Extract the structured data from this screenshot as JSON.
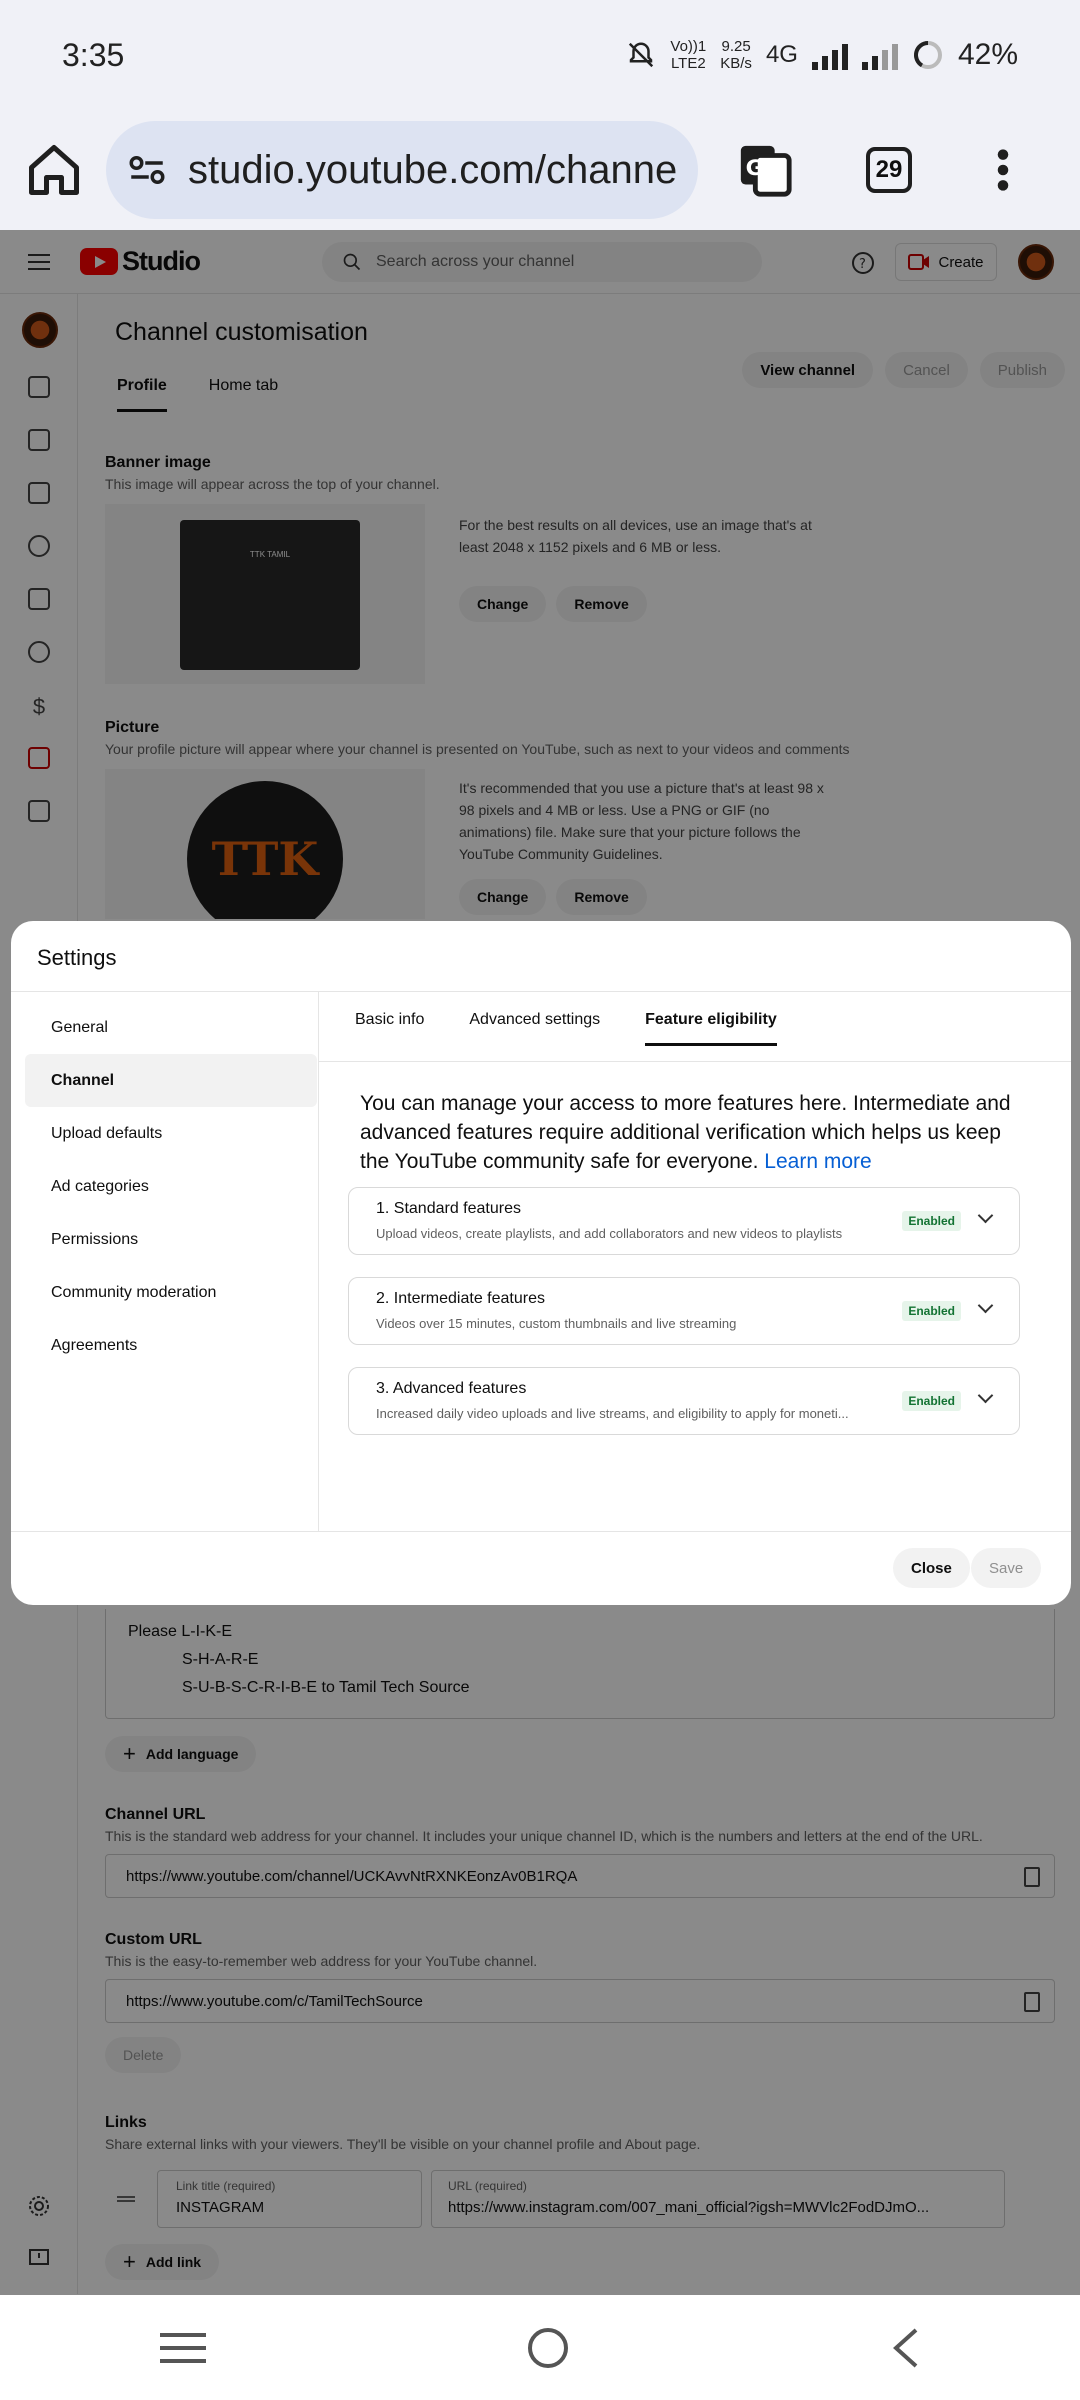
{
  "status_bar": {
    "time": "3:35",
    "net_top": "Vo))1",
    "net_bottom": "LTE2",
    "speed_top": "9.25",
    "speed_bottom": "KB/s",
    "network": "4G",
    "battery": "42%"
  },
  "browser": {
    "url": "studio.youtube.com/channe",
    "tab_count": "29"
  },
  "studio": {
    "logo_text": "Studio",
    "search_placeholder": "Search across your channel",
    "create_label": "Create",
    "page_title": "Channel customisation",
    "tabs": [
      "Profile",
      "Home tab"
    ],
    "header_buttons": [
      "View channel",
      "Cancel",
      "Publish"
    ],
    "banner": {
      "title": "Banner image",
      "subtitle": "This image will appear across the top of your channel.",
      "info": "For the best results on all devices, use an image that's at least 2048 x 1152 pixels and 6 MB or less.",
      "change": "Change",
      "remove": "Remove",
      "preview_text": "TTK TAMIL"
    },
    "picture": {
      "title": "Picture",
      "subtitle": "Your profile picture will appear where your channel is presented on YouTube, such as next to your videos and comments",
      "info": "It's recommended that you use a picture that's at least 98 x 98 pixels and 4 MB or less. Use a PNG or GIF (no animations) file. Make sure that your picture follows the YouTube Community Guidelines.",
      "change": "Change",
      "remove": "Remove",
      "logo_text": "TTK"
    },
    "description_lines": [
      "Please L-I-K-E",
      "S-H-A-R-E",
      "S-U-B-S-C-R-I-B-E to Tamil Tech Source"
    ],
    "add_language": "Add language",
    "channel_url": {
      "title": "Channel URL",
      "subtitle": "This is the standard web address for your channel. It includes your unique channel ID, which is the numbers and letters at the end of the URL.",
      "value": "https://www.youtube.com/channel/UCKAvvNtRXNKEonzAv0B1RQA"
    },
    "custom_url": {
      "title": "Custom URL",
      "subtitle": "This is the easy-to-remember web address for your YouTube channel.",
      "value": "https://www.youtube.com/c/TamilTechSource",
      "delete": "Delete"
    },
    "links": {
      "title": "Links",
      "subtitle": "Share external links with your viewers. They'll be visible on your channel profile and About page.",
      "title_label": "Link title (required)",
      "title_value": "INSTAGRAM",
      "url_label": "URL (required)",
      "url_value": "https://www.instagram.com/007_mani_official?igsh=MWVlc2FodDJmO...",
      "add_link": "Add link"
    }
  },
  "modal": {
    "title": "Settings",
    "sidebar": [
      "General",
      "Channel",
      "Upload defaults",
      "Ad categories",
      "Permissions",
      "Community moderation",
      "Agreements"
    ],
    "tabs": [
      "Basic info",
      "Advanced settings",
      "Feature eligibility"
    ],
    "intro": "You can manage your access to more features here. Intermediate and advanced features require additional verification which helps us keep the YouTube community safe for everyone. ",
    "learn_more": "Learn more",
    "features": [
      {
        "title": "1. Standard features",
        "desc": "Upload videos, create playlists, and add collaborators and new videos to playlists",
        "status": "Enabled"
      },
      {
        "title": "2. Intermediate features",
        "desc": "Videos over 15 minutes, custom thumbnails and live streaming",
        "status": "Enabled"
      },
      {
        "title": "3. Advanced features",
        "desc": "Increased daily video uploads and live streams, and eligibility to apply for moneti...",
        "status": "Enabled"
      }
    ],
    "close": "Close",
    "save": "Save"
  }
}
